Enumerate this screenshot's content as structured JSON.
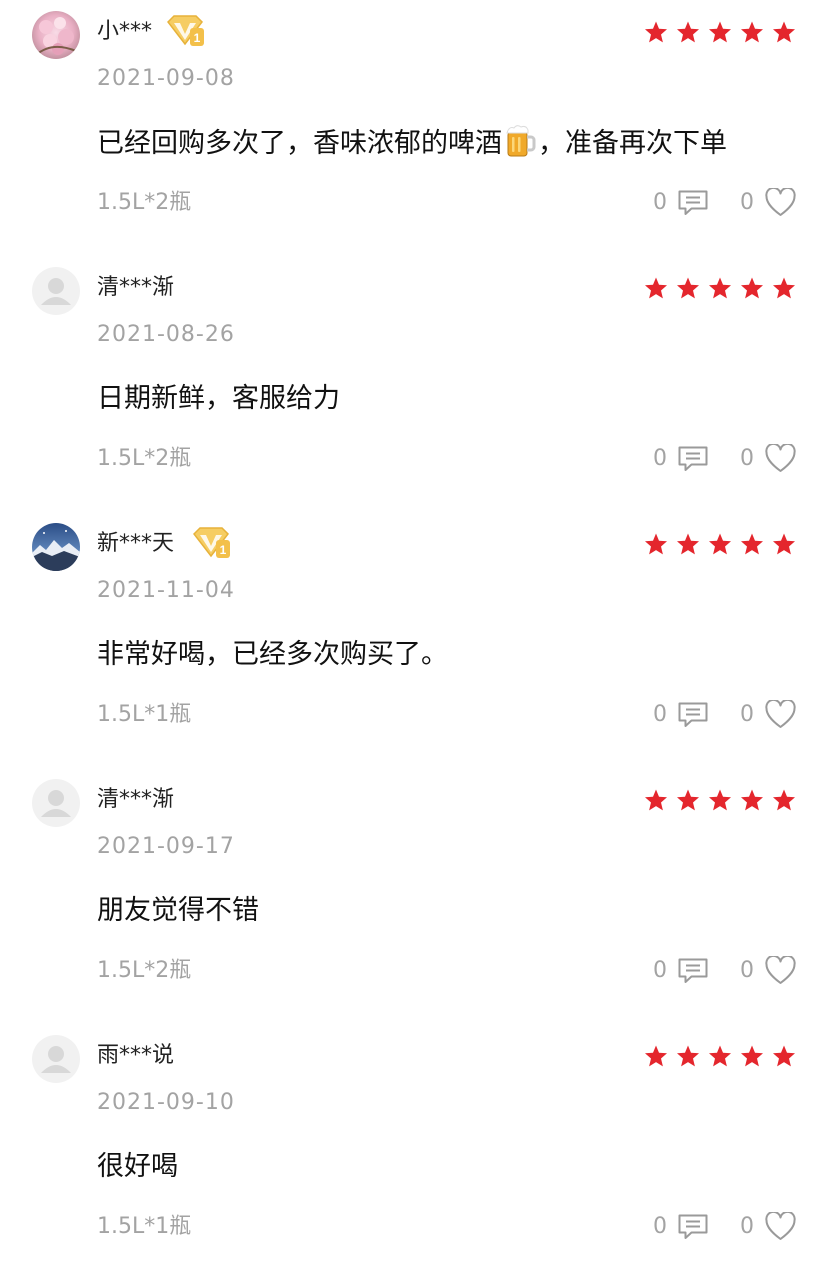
{
  "reviews": [
    {
      "username": "小***",
      "avatar": "cherry-blossom-photo",
      "vip": true,
      "rating": 5,
      "date": "2021-09-08",
      "content_before_emoji": "已经回购多次了，香味浓郁的啤酒",
      "content_emoji": "beer-mug-emoji",
      "content_after_emoji": "，准备再次下单",
      "spec": "1.5L*2瓶",
      "reply_count": "0",
      "like_count": "0"
    },
    {
      "username": "清***渐",
      "avatar": "default-avatar",
      "vip": false,
      "rating": 5,
      "date": "2021-08-26",
      "content": "日期新鲜，客服给力",
      "spec": "1.5L*2瓶",
      "reply_count": "0",
      "like_count": "0"
    },
    {
      "username": "新***天",
      "avatar": "snowy-mountain-photo",
      "vip": true,
      "rating": 5,
      "date": "2021-11-04",
      "content": "非常好喝，已经多次购买了。",
      "spec": "1.5L*1瓶",
      "reply_count": "0",
      "like_count": "0"
    },
    {
      "username": "清***渐",
      "avatar": "default-avatar",
      "vip": false,
      "rating": 5,
      "date": "2021-09-17",
      "content": "朋友觉得不错",
      "spec": "1.5L*2瓶",
      "reply_count": "0",
      "like_count": "0"
    },
    {
      "username": "雨***说",
      "avatar": "default-avatar",
      "vip": false,
      "rating": 5,
      "date": "2021-09-10",
      "content": "很好喝",
      "spec": "1.5L*1瓶",
      "reply_count": "0",
      "like_count": "0"
    }
  ],
  "colors": {
    "star": "#e4262d",
    "meta_text": "#a3a3a3",
    "body_text": "#111111",
    "vip_badge": "#f3c04a"
  },
  "icons": {
    "reply": "comment-icon",
    "like": "heart-outline-icon",
    "vip": "vip-diamond-badge-icon",
    "star": "star-icon"
  }
}
